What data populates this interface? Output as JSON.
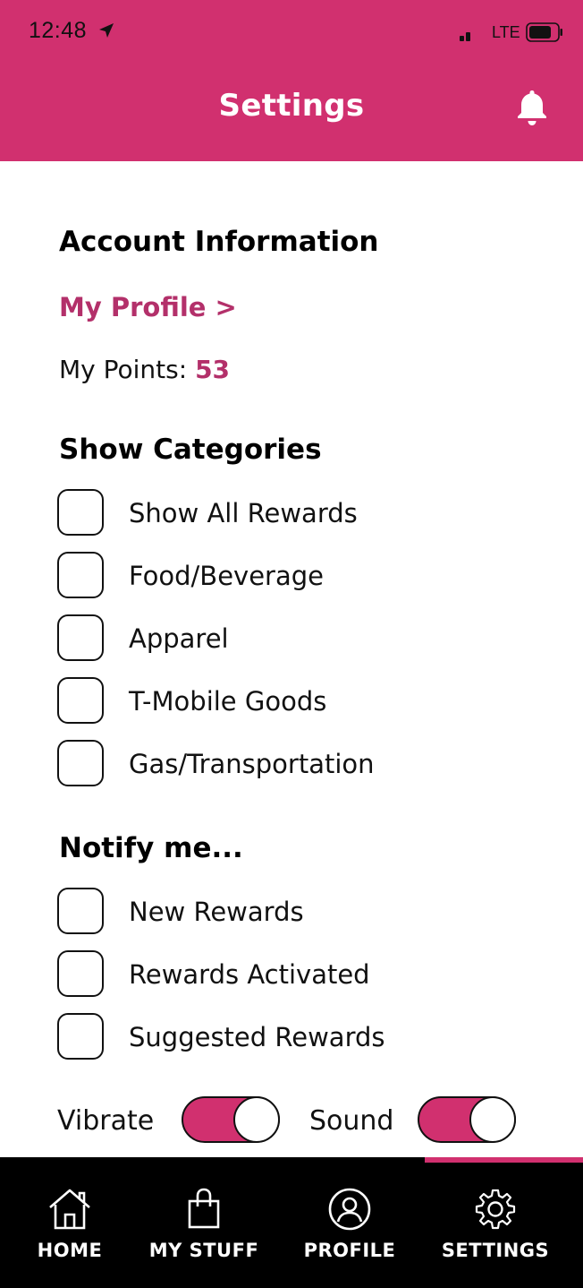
{
  "status_bar": {
    "time": "12:48",
    "network": "LTE"
  },
  "header": {
    "title": "Settings",
    "background_color": "#d1306f"
  },
  "account": {
    "title": "Account Information",
    "profile_link": "My Profile >",
    "points_label": "My Points: ",
    "points_value": "53"
  },
  "categories": {
    "title": "Show Categories",
    "items": [
      {
        "label": "Show All Rewards",
        "checked": false
      },
      {
        "label": "Food/Beverage",
        "checked": false
      },
      {
        "label": "Apparel",
        "checked": false
      },
      {
        "label": "T-Mobile Goods",
        "checked": false
      },
      {
        "label": "Gas/Transportation",
        "checked": false
      }
    ]
  },
  "notify": {
    "title": "Notify me...",
    "items": [
      {
        "label": "New Rewards",
        "checked": false
      },
      {
        "label": "Rewards Activated",
        "checked": false
      },
      {
        "label": "Suggested Rewards",
        "checked": false
      }
    ]
  },
  "toggles": {
    "vibrate": {
      "label": "Vibrate",
      "on": true
    },
    "sound": {
      "label": "Sound",
      "on": true
    }
  },
  "bottom_nav": {
    "items": [
      {
        "label": "HOME",
        "icon": "home-icon"
      },
      {
        "label": "MY STUFF",
        "icon": "shopping-bag-icon"
      },
      {
        "label": "PROFILE",
        "icon": "user-circle-icon"
      },
      {
        "label": "SETTINGS",
        "icon": "gear-icon",
        "active": true
      }
    ],
    "active_color": "#d1306f"
  }
}
